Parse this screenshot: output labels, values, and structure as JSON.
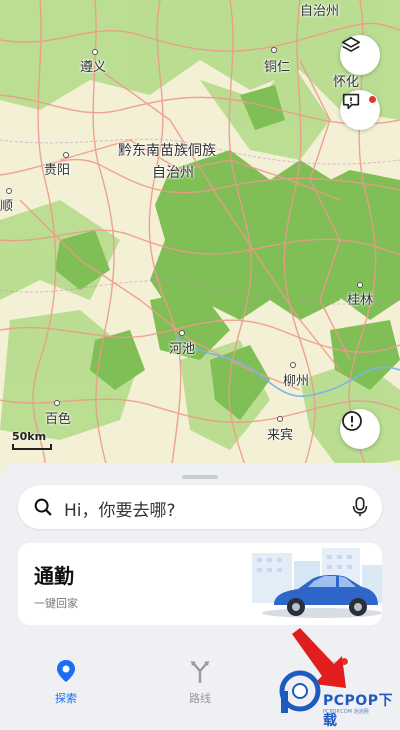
{
  "map": {
    "cities": [
      {
        "name": "遵义"
      },
      {
        "name": "铜仁"
      },
      {
        "name": "怀化"
      },
      {
        "name": "黔东南苗族侗族"
      },
      {
        "name": "自治州"
      },
      {
        "name": "贵阳"
      },
      {
        "name": "顺"
      },
      {
        "name": "河池"
      },
      {
        "name": "柳州"
      },
      {
        "name": "桂林"
      },
      {
        "name": "百色"
      },
      {
        "name": "来宾"
      },
      {
        "name": "自治州"
      }
    ],
    "scale_label": "50km",
    "buttons": {
      "layers": "layers-icon",
      "feedback": "feedback-icon",
      "alert": "alert-icon"
    }
  },
  "search": {
    "placeholder": "Hi，你要去哪?"
  },
  "commute_card": {
    "title": "通勤",
    "subtitle": "一键回家"
  },
  "tabs": [
    {
      "label": "探索",
      "active": true,
      "color": "#1a6ef5"
    },
    {
      "label": "路线",
      "active": false,
      "color": "#9a9a9a"
    }
  ],
  "watermark": {
    "brand": "PCPOP下载",
    "tagline": "PCPOP.COM 泡泡网"
  },
  "colors": {
    "accent": "#1a6ef5",
    "map_green": "#8cc466",
    "road": "#ee9a8a",
    "notice": "#e5352b"
  }
}
